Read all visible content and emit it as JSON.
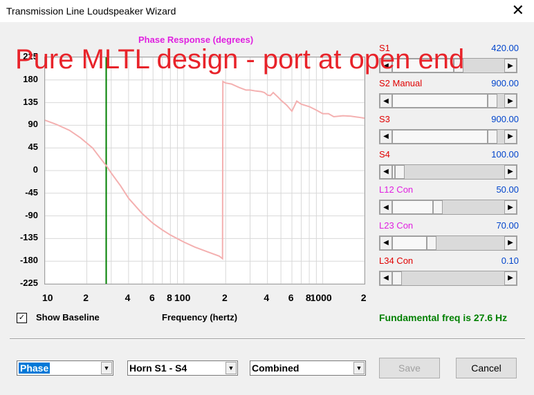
{
  "window": {
    "title": "Transmission Line Loudspeaker Wizard",
    "close_glyph": "✕"
  },
  "overlay_text": "Pure MLTL design - port at open end",
  "chart_data": {
    "type": "line",
    "title": "Phase Response (degrees)",
    "xlabel": "Frequency (hertz)",
    "ylabel": "",
    "xscale": "log",
    "xlim": [
      10,
      2000
    ],
    "ylim": [
      -225,
      225
    ],
    "y_ticks": [
      225,
      180,
      135,
      90,
      45,
      0,
      -45,
      -90,
      -135,
      -180,
      -225
    ],
    "x_tick_labels": [
      "10",
      "2",
      "4",
      "6",
      "8",
      "100",
      "2",
      "4",
      "6",
      "8",
      "1000",
      "2"
    ],
    "grid": true,
    "marker_frequency": 27.6,
    "series": [
      {
        "color": "#f4b0b0",
        "x": [
          10,
          12,
          15,
          18,
          22,
          25,
          27.6,
          30,
          35,
          40,
          50,
          60,
          70,
          80,
          100,
          120,
          150,
          180,
          190,
          191,
          200,
          220,
          250,
          280,
          300,
          330,
          360,
          380,
          400,
          420,
          440,
          460,
          480,
          500,
          550,
          600,
          650,
          700,
          800,
          900,
          1000,
          1100,
          1200,
          1400,
          1600,
          1800,
          2000
        ],
        "y": [
          100,
          92,
          80,
          65,
          45,
          25,
          10,
          -5,
          -30,
          -55,
          -85,
          -105,
          -118,
          -128,
          -142,
          -152,
          -162,
          -170,
          -175,
          177,
          174,
          172,
          165,
          160,
          160,
          158,
          157,
          155,
          150,
          149,
          155,
          150,
          145,
          140,
          130,
          118,
          138,
          132,
          127,
          120,
          113,
          113,
          107,
          109,
          108,
          106,
          104
        ]
      }
    ]
  },
  "sliders": [
    {
      "label": "S1",
      "value": "420.00",
      "color": "#e00000",
      "thumb": 0.6
    },
    {
      "label": "S2  Manual",
      "value": "900.00",
      "color": "#e00000",
      "thumb": 0.93
    },
    {
      "label": "S3",
      "value": "900.00",
      "color": "#e00000",
      "thumb": 0.93
    },
    {
      "label": "S4",
      "value": "100.00",
      "color": "#e00000",
      "thumb": 0.03
    },
    {
      "label": "L12  Con",
      "value": "50.00",
      "color": "#e020e0",
      "thumb": 0.4
    },
    {
      "label": "L23  Con",
      "value": "70.00",
      "color": "#e020e0",
      "thumb": 0.34
    },
    {
      "label": "L34  Con",
      "value": "0.10",
      "color": "#e00000",
      "thumb": 0.0
    }
  ],
  "show_baseline": {
    "label": "Show Baseline",
    "checked": true,
    "check_glyph": "✓"
  },
  "freq_label": "Frequency (hertz)",
  "fundamental": "Fundamental freq is 27.6 Hz",
  "combos": [
    {
      "value": "Phase",
      "selected": true
    },
    {
      "value": "Horn S1 - S4",
      "selected": false
    },
    {
      "value": "Combined",
      "selected": false
    }
  ],
  "buttons": {
    "save": "Save",
    "cancel": "Cancel"
  }
}
